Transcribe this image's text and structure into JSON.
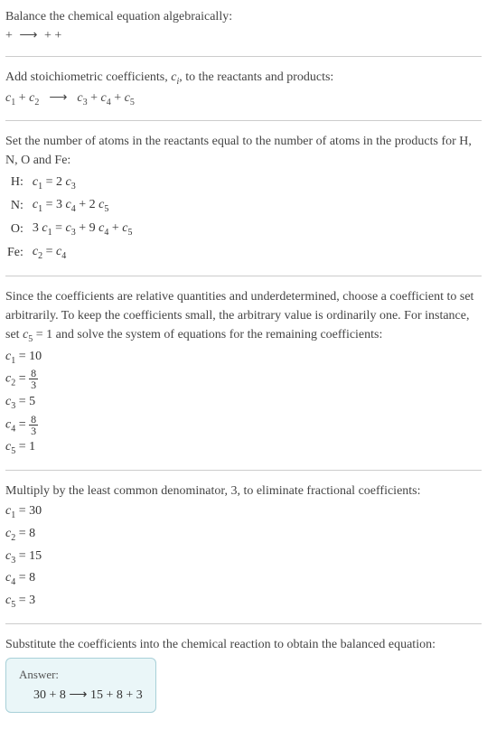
{
  "intro": {
    "line1": "Balance the chemical equation algebraically:",
    "line2_prefix": " + ",
    "line2_arrow": "⟶",
    "line2_suffix": " + + "
  },
  "stoich": {
    "line1": "Add stoichiometric coefficients, ",
    "c_var": "c",
    "c_sub": "i",
    "line1_suffix": ", to the reactants and products:",
    "eq_c1": "c",
    "eq_s1": "1",
    "plus": " + ",
    "eq_c2": "c",
    "eq_s2": "2",
    "arrow": "⟶",
    "eq_c3": "c",
    "eq_s3": "3",
    "eq_c4": "c",
    "eq_s4": "4",
    "eq_c5": "c",
    "eq_s5": "5"
  },
  "atoms": {
    "intro": "Set the number of atoms in the reactants equal to the number of atoms in the products for H, N, O and Fe:",
    "rows": [
      {
        "label": "H:",
        "lhs_c": "c",
        "lhs_s": "1",
        "eq": " = 2 ",
        "rhs_c": "c",
        "rhs_s": "3",
        "extra": ""
      },
      {
        "label": "N:",
        "lhs_c": "c",
        "lhs_s": "1",
        "eq": " = 3 ",
        "rhs_c": "c",
        "rhs_s": "4",
        "extra_pre": " + 2 ",
        "extra_c": "c",
        "extra_s": "5"
      },
      {
        "label": "O:",
        "lhs_pre": "3 ",
        "lhs_c": "c",
        "lhs_s": "1",
        "eq": " = ",
        "rhs_c": "c",
        "rhs_s": "3",
        "extra_pre": " + 9 ",
        "extra_c": "c",
        "extra_s": "4",
        "extra2_pre": " + ",
        "extra2_c": "c",
        "extra2_s": "5"
      },
      {
        "label": "Fe:",
        "lhs_c": "c",
        "lhs_s": "2",
        "eq": " = ",
        "rhs_c": "c",
        "rhs_s": "4",
        "extra": ""
      }
    ]
  },
  "choose": {
    "text": "Since the coefficients are relative quantities and underdetermined, choose a coefficient to set arbitrarily. To keep the coefficients small, the arbitrary value is ordinarily one. For instance, set ",
    "cvar": "c",
    "csub": "5",
    "text2": " = 1 and solve the system of equations for the remaining coefficients:",
    "coefs": {
      "c1": {
        "c": "c",
        "s": "1",
        "eq": " = 10"
      },
      "c2": {
        "c": "c",
        "s": "2",
        "eq": " = ",
        "num": "8",
        "den": "3"
      },
      "c3": {
        "c": "c",
        "s": "3",
        "eq": " = 5"
      },
      "c4": {
        "c": "c",
        "s": "4",
        "eq": " = ",
        "num": "8",
        "den": "3"
      },
      "c5": {
        "c": "c",
        "s": "5",
        "eq": " = 1"
      }
    }
  },
  "multiply": {
    "text": "Multiply by the least common denominator, 3, to eliminate fractional coefficients:",
    "coefs": {
      "c1": {
        "c": "c",
        "s": "1",
        "eq": " = 30"
      },
      "c2": {
        "c": "c",
        "s": "2",
        "eq": " = 8"
      },
      "c3": {
        "c": "c",
        "s": "3",
        "eq": " = 15"
      },
      "c4": {
        "c": "c",
        "s": "4",
        "eq": " = 8"
      },
      "c5": {
        "c": "c",
        "s": "5",
        "eq": " = 3"
      }
    }
  },
  "substitute": {
    "text": "Substitute the coefficients into the chemical reaction to obtain the balanced equation:"
  },
  "answer": {
    "label": "Answer:",
    "eq": "30  + 8  ⟶  15  + 8  + 3 "
  }
}
